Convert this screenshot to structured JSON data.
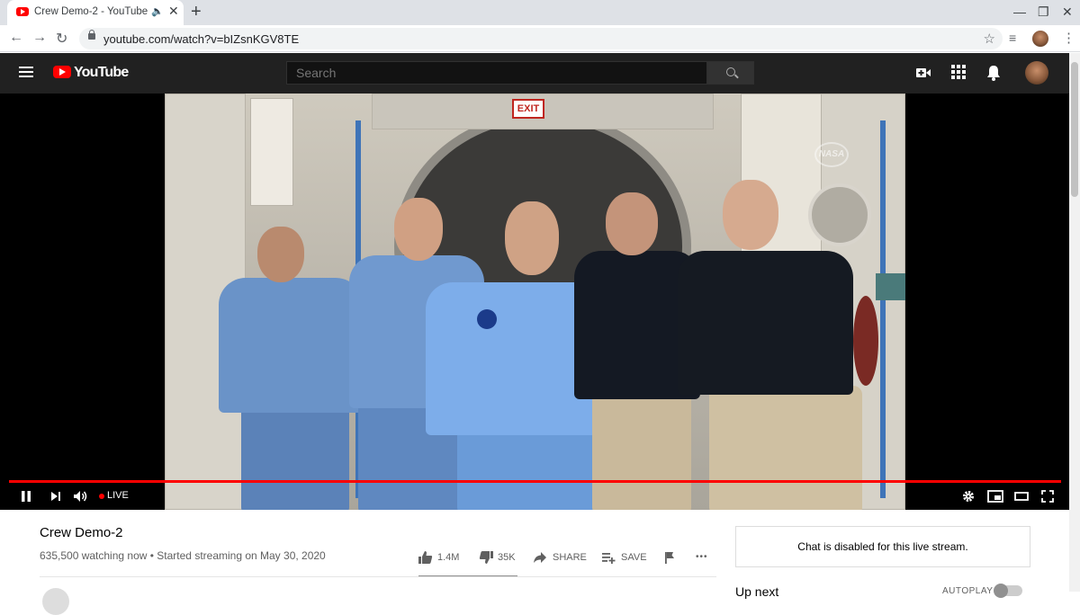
{
  "browser": {
    "tab_title": "Crew Demo-2 - YouTube",
    "tab_close": "✕",
    "new_tab": "+",
    "url": "youtube.com/watch?v=bIZsnKGV8TE",
    "window_controls": [
      "—",
      "❐",
      "✕"
    ]
  },
  "youtube": {
    "logo_text": "YouTube",
    "search_placeholder": "Search"
  },
  "player": {
    "live_label": "LIVE",
    "exit_sign": "EXIT",
    "watermark": "NASA",
    "accent_color": "#ff0000"
  },
  "video": {
    "title": "Crew Demo-2",
    "info": "635,500 watching now • Started streaming on May 30, 2020",
    "likes": "1.4M",
    "dislikes": "35K",
    "share_label": "SHARE",
    "save_label": "SAVE",
    "more_label": "•••"
  },
  "sidebar": {
    "chat_notice": "Chat is disabled for this live stream.",
    "up_next": "Up next",
    "autoplay": "AUTOPLAY"
  }
}
